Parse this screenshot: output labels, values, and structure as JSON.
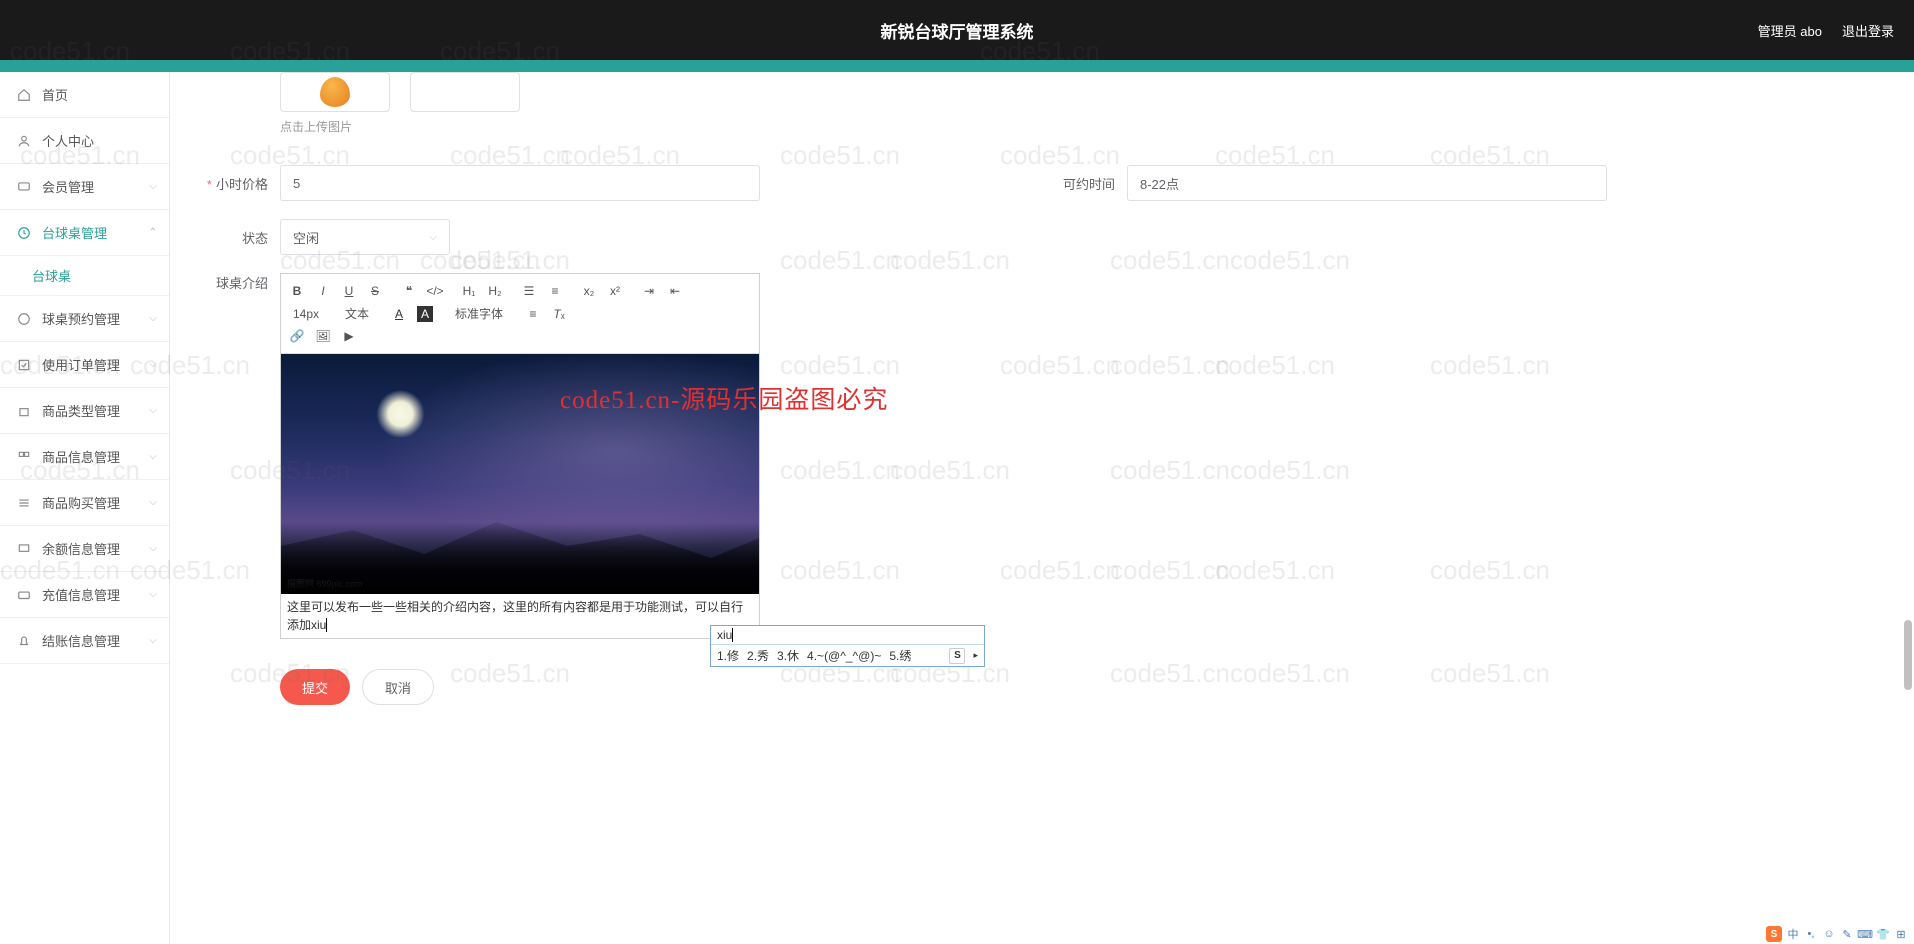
{
  "header": {
    "title": "新锐台球厅管理系统",
    "admin_label": "管理员 abo",
    "logout_label": "退出登录"
  },
  "sidebar": {
    "items": [
      {
        "label": "首页",
        "icon": "home"
      },
      {
        "label": "个人中心",
        "icon": "user"
      },
      {
        "label": "会员管理",
        "icon": "chat",
        "expandable": true
      },
      {
        "label": "台球桌管理",
        "icon": "clock",
        "expandable": true,
        "expanded": true
      },
      {
        "label": "球桌预约管理",
        "icon": "clock2",
        "expandable": true
      },
      {
        "label": "使用订单管理",
        "icon": "check",
        "expandable": true
      },
      {
        "label": "商品类型管理",
        "icon": "box",
        "expandable": true
      },
      {
        "label": "商品信息管理",
        "icon": "grid",
        "expandable": true
      },
      {
        "label": "商品购买管理",
        "icon": "list",
        "expandable": true
      },
      {
        "label": "余额信息管理",
        "icon": "monitor",
        "expandable": true
      },
      {
        "label": "充值信息管理",
        "icon": "card",
        "expandable": true
      },
      {
        "label": "结账信息管理",
        "icon": "bell",
        "expandable": true
      }
    ],
    "sub_item": "台球桌"
  },
  "form": {
    "upload_hint": "点击上传图片",
    "hour_price": {
      "label": "小时价格",
      "value": "5"
    },
    "avail_time": {
      "label": "可约时间",
      "value": "8-22点"
    },
    "status": {
      "label": "状态",
      "value": "空闲"
    },
    "intro": {
      "label": "球桌介绍"
    }
  },
  "editor": {
    "font_size": "14px",
    "font_style_label": "文本",
    "font_family_label": "标准字体",
    "content_text": "这里可以发布一些一些相关的介绍内容，这里的所有内容都是用于功能测试，可以自行添加xiu",
    "image_watermark": "摄图网 699pic.com"
  },
  "ime": {
    "input": "xiu",
    "candidates": [
      "1.修",
      "2.秀",
      "3.休",
      "4.~(@^_^@)~",
      "5.绣"
    ]
  },
  "buttons": {
    "submit": "提交",
    "cancel": "取消"
  },
  "watermark": {
    "text": "code51.cn",
    "red": "code51.cn-源码乐园盗图必究"
  }
}
